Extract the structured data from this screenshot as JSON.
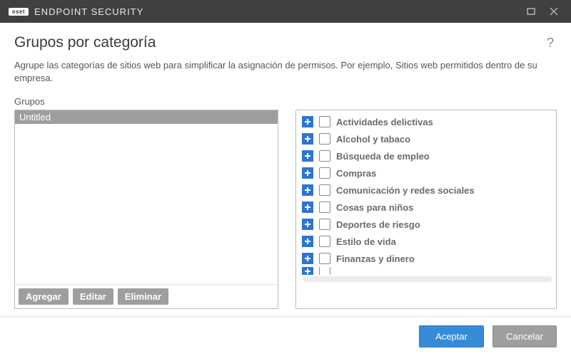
{
  "titlebar": {
    "brand": "eset",
    "product": "ENDPOINT SECURITY"
  },
  "page": {
    "title": "Grupos por categoría",
    "description": "Agrupe las categorías de sitios web para simplificar la asignación de permisos. Por ejemplo, Sitios web permitidos dentro de su empresa."
  },
  "groups": {
    "label": "Grupos",
    "items": [
      "Untitled"
    ],
    "buttons": {
      "add": "Agregar",
      "edit": "Editar",
      "delete": "Eliminar"
    }
  },
  "categories": [
    "Actividades delictivas",
    "Alcohol y tabaco",
    "Búsqueda de empleo",
    "Compras",
    "Comunicación y redes sociales",
    "Cosas para niños",
    "Deportes de riesgo",
    "Estilo de vida",
    "Finanzas y dinero"
  ],
  "footer": {
    "ok": "Aceptar",
    "cancel": "Cancelar"
  }
}
